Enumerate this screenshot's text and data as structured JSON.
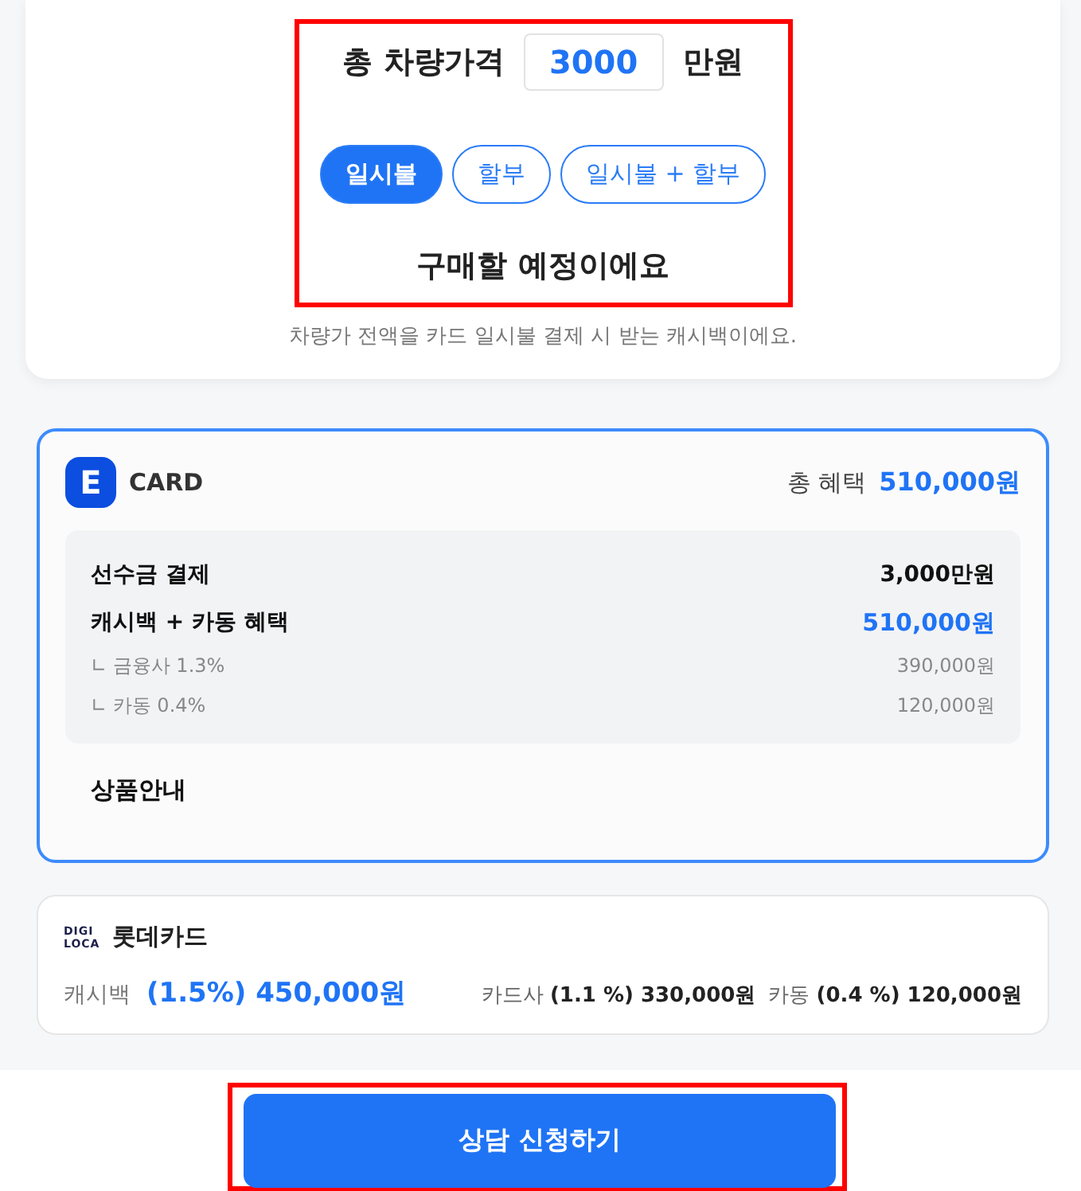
{
  "price": {
    "label": "총 차량가격",
    "value": "3000",
    "unit": "만원",
    "highlighted": true
  },
  "payment_options": [
    {
      "label": "일시불",
      "selected": true
    },
    {
      "label": "할부",
      "selected": false
    },
    {
      "label": "일시불 + 할부",
      "selected": false
    }
  ],
  "plan_text": "구매할 예정이에요",
  "caption": "차량가 전액을 카드 일시불 결제 시 받는 캐시백이에요.",
  "e_card": {
    "logo": "E",
    "name": "CARD",
    "selected": true,
    "total_label": "총 혜택",
    "total_value": "510,000원",
    "rows": [
      {
        "kind": "main",
        "label": "선수금 결제",
        "value": "3,000만원"
      },
      {
        "kind": "accent",
        "label": "캐시백 + 카동 혜택",
        "value": "510,000원"
      },
      {
        "kind": "sub",
        "label": "∟ 금융사 1.3%",
        "value": "390,000원"
      },
      {
        "kind": "sub",
        "label": "∟ 카동 0.4%",
        "value": "120,000원"
      }
    ],
    "product_info": "상품안내"
  },
  "loca_card": {
    "logo_lines": [
      "DIGI",
      "LOCA"
    ],
    "name": "롯데카드",
    "cashback_label": "캐시백",
    "cashback_value": "(1.5%) 450,000원",
    "breakdown": [
      "카드사 **(1.1 %) 330,000원**",
      "카동 **(0.4 %) 120,000원**"
    ]
  },
  "cta": {
    "label": "상담 신청하기",
    "highlighted": true
  }
}
